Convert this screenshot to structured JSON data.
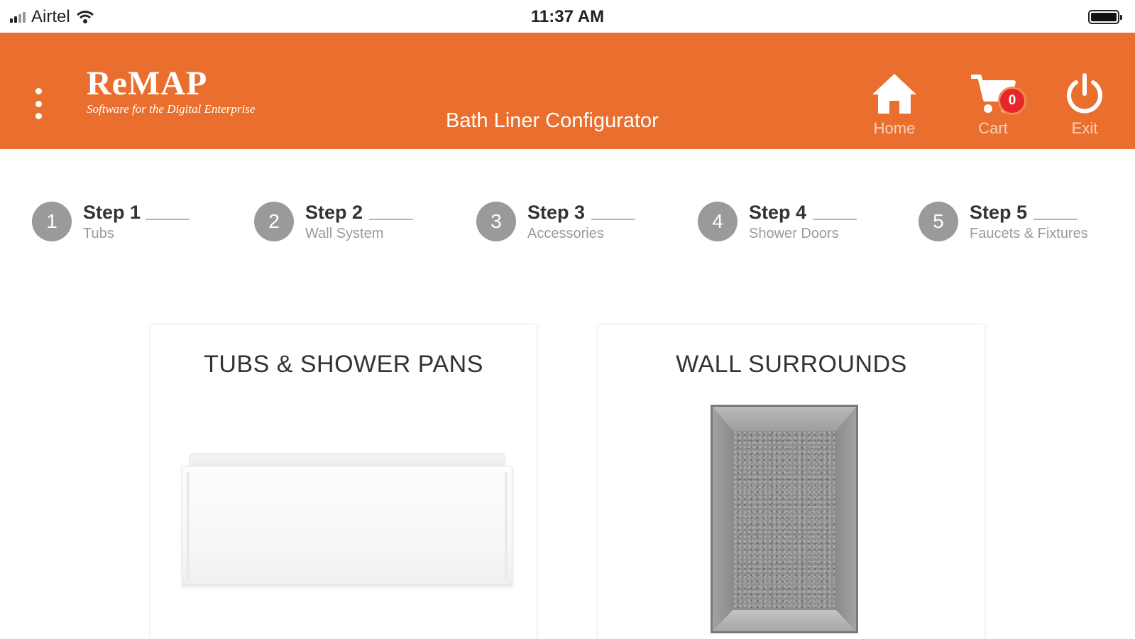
{
  "status_bar": {
    "carrier": "Airtel",
    "time": "11:37 AM"
  },
  "header": {
    "logo": {
      "name": "ReMAP",
      "tagline": "Software for the Digital Enterprise"
    },
    "title": "Bath Liner Configurator",
    "buttons": {
      "home": "Home",
      "cart": "Cart",
      "exit": "Exit"
    },
    "cart_count": "0",
    "accent_color": "#ea6f2e"
  },
  "steps": [
    {
      "number": "1",
      "title": "Step 1",
      "subtitle": "Tubs"
    },
    {
      "number": "2",
      "title": "Step 2",
      "subtitle": "Wall System"
    },
    {
      "number": "3",
      "title": "Step 3",
      "subtitle": "Accessories"
    },
    {
      "number": "4",
      "title": "Step 4",
      "subtitle": "Shower Doors"
    },
    {
      "number": "5",
      "title": "Step 5",
      "subtitle": "Faucets & Fixtures"
    }
  ],
  "categories": [
    {
      "title": "TUBS & SHOWER PANS",
      "image": "bathtub"
    },
    {
      "title": "WALL SURROUNDS",
      "image": "wall-surround"
    }
  ]
}
